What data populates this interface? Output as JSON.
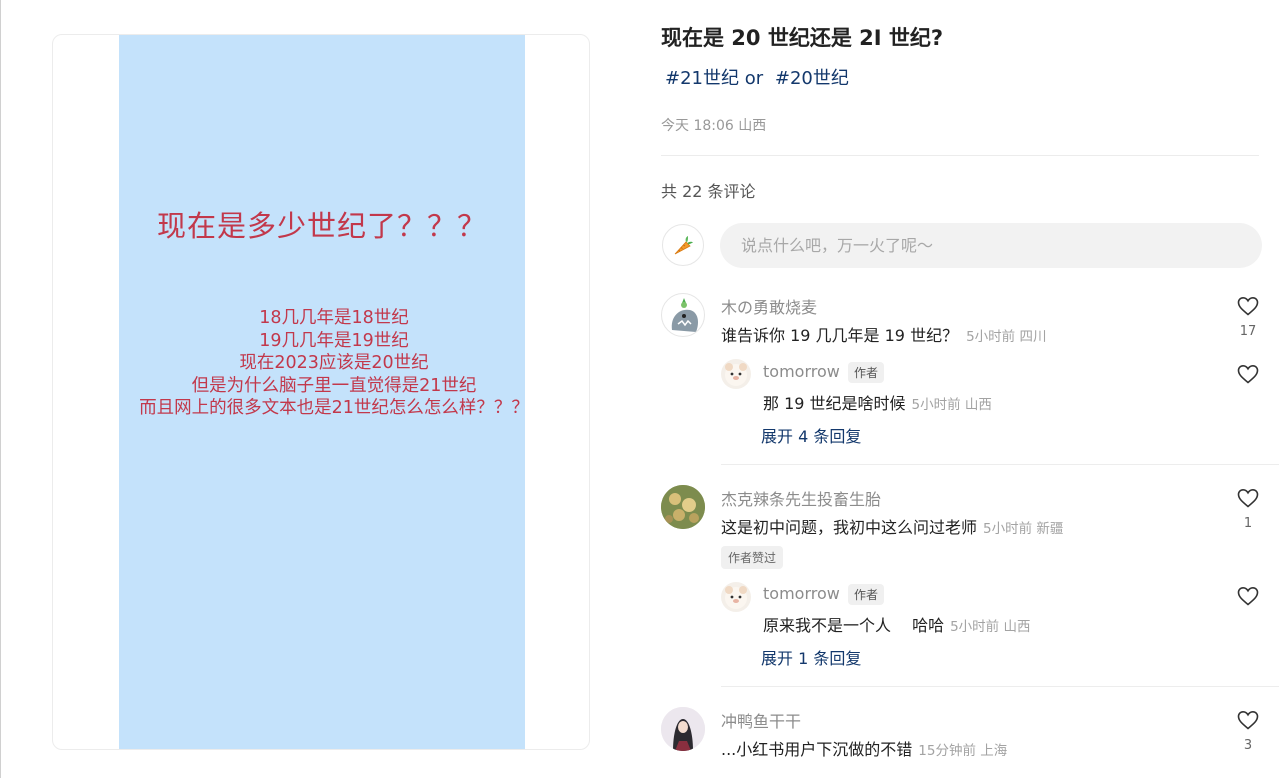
{
  "poster": {
    "title": "现在是多少世纪了？？？",
    "lines": [
      "18几几年是18世纪",
      "19几几年是19世纪",
      "现在2023应该是20世纪",
      "但是为什么脑子里一直觉得是21世纪",
      "而且网上的很多文本也是21世纪怎么怎么样？？？"
    ]
  },
  "note": {
    "title": "现在是 20 世纪还是 2I 世纪?",
    "tags": [
      "#21世纪 or",
      "#20世纪"
    ],
    "meta": "今天 18:06 山西"
  },
  "comments_header": {
    "count_text": "共 22 条评论"
  },
  "composer": {
    "placeholder": "说点什么吧，万一火了呢～",
    "avatar_icon": "carrot-icon"
  },
  "comments": [
    {
      "name": "木の勇敢烧麦",
      "text": "谁告诉你 19 几几年是 19 世纪？",
      "time": "5小时前 四川",
      "likes": "17",
      "reply": {
        "name": "tomorrow",
        "badge": "作者",
        "text": "那 19 世纪是啥时候",
        "time": "5小时前 山西"
      },
      "expand": "展开 4 条回复"
    },
    {
      "name": "杰克辣条先生投畜生胎",
      "text": "这是初中问题，我初中这么问过老师",
      "time": "5小时前 新疆",
      "likes": "1",
      "liked_badge": "作者赞过",
      "reply": {
        "name": "tomorrow",
        "badge": "作者",
        "text": "原来我不是一个人　 哈哈",
        "time": "5小时前 山西"
      },
      "expand": "展开 1 条回复"
    },
    {
      "name": "冲鸭鱼干干",
      "text": "...小红书用户下沉做的不错",
      "time": "15分钟前 上海",
      "likes": "3"
    }
  ],
  "colors": {
    "poster_bg": "#c4e2fb",
    "poster_text": "#c2384b",
    "tag": "#13386c",
    "link": "#13386c"
  }
}
